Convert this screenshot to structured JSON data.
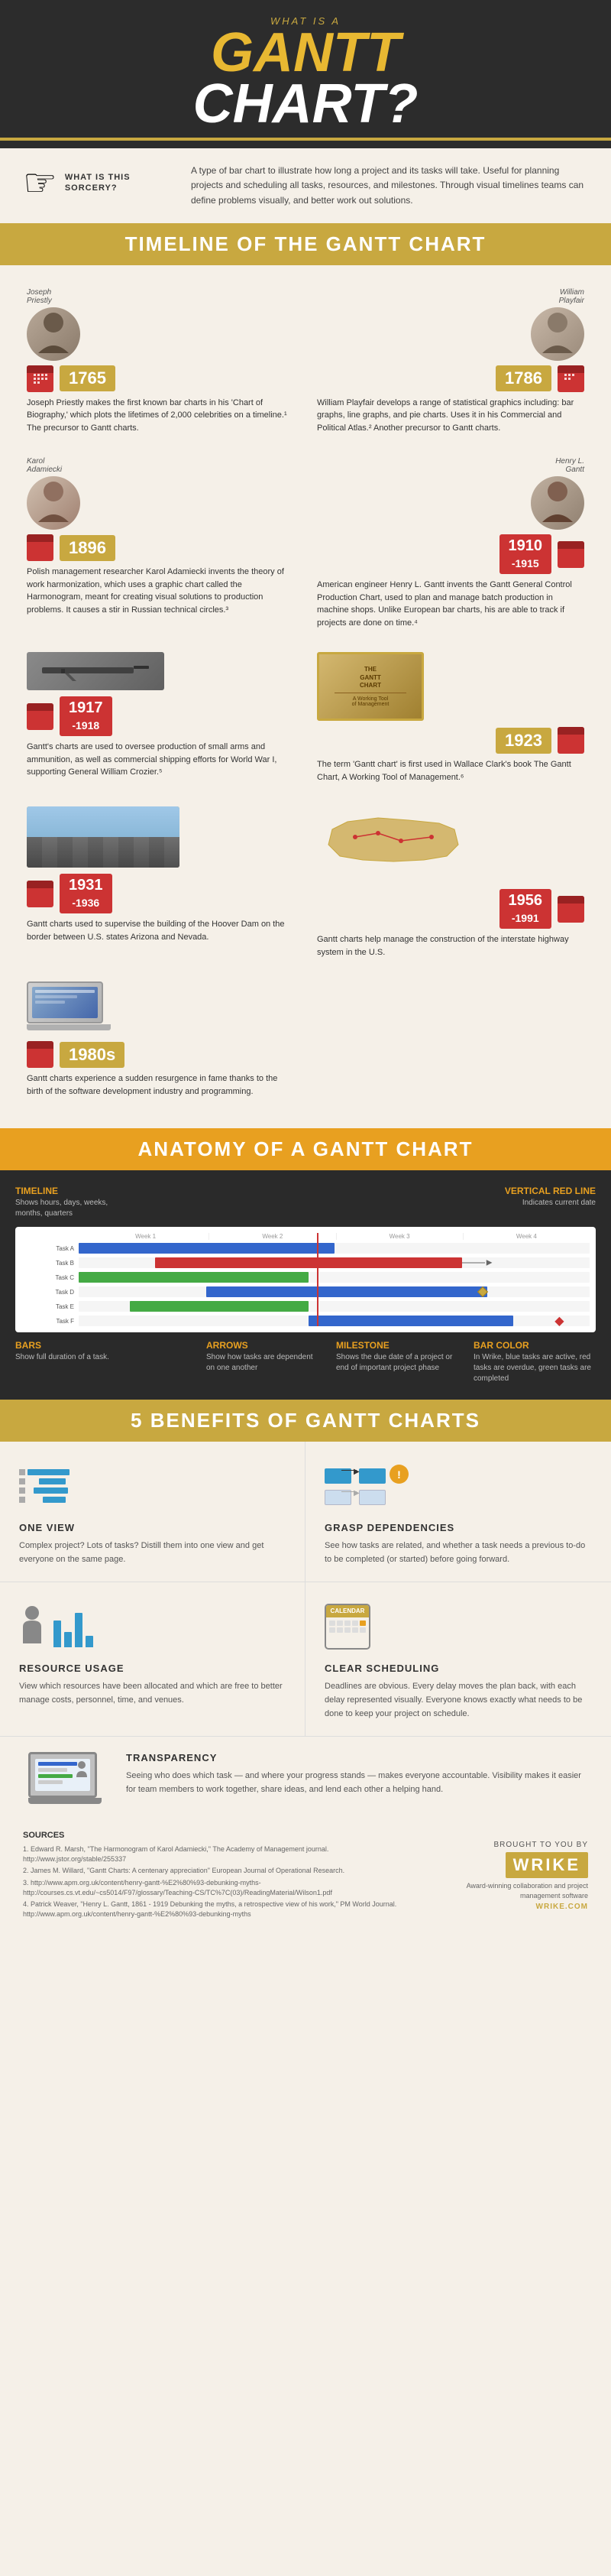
{
  "header": {
    "eyebrow": "What is a",
    "title_line1": "Gantt",
    "title_line2": "Chart?",
    "sorcery_label": "What is this\nSorcery?",
    "sorcery_text": "A type of bar chart to illustrate how long a project and its tasks will take. Useful for planning projects and scheduling all tasks, resources, and milestones. Through visual timelines teams can define problems visually, and better work out solutions."
  },
  "timeline": {
    "section_title": "Timeline of the Gantt Chart",
    "events": [
      {
        "year": "1765",
        "side": "left",
        "person": "Joseph Priestley",
        "text": "Joseph Priestly makes the first known bar charts in his 'Chart of Biography,' which plots the lifetimes of 2,000 celebrities on a timeline.¹ The precursor to Gantt charts."
      },
      {
        "year": "1786",
        "side": "right",
        "person": "William Playfair",
        "text": "William Playfair develops a range of statistical graphics including: bar graphs, line graphs, and pie charts. Uses it in his Commercial and Political Atlas.² Another precursor to Gantt charts."
      },
      {
        "year": "1896",
        "side": "left",
        "person": "Karol Adamiecki",
        "text": "Polish management researcher Karol Adamiecki invents the theory of work harmonization, which uses a graphic chart called the Harmonogram, meant for creating visual solutions to production problems. It causes a stir in Russian technical circles.³"
      },
      {
        "year": "1910\n-1915",
        "side": "right",
        "person": "Henry L. Gantt",
        "text": "American engineer Henry L. Gantt invents the Gantt General Control Production Chart, used to plan and manage batch production in machine shops. Unlike European bar charts, his are able to track if projects are done on time.⁴"
      },
      {
        "year": "1917\n-1918",
        "side": "left",
        "text": "Gantt's charts are used to oversee production of small arms and ammunition, as well as commercial shipping efforts for World War I, supporting General William Crozier.⁵"
      },
      {
        "year": "1923",
        "side": "right",
        "text": "The term 'Gantt chart' is first used in Wallace Clark's book The Gantt Chart, A Working Tool of Management.⁶"
      },
      {
        "year": "1931\n-1936",
        "side": "left",
        "text": "Gantt charts used to supervise the building of the Hoover Dam on the border between U.S. states Arizona and Nevada."
      },
      {
        "year": "1956\n-1991",
        "side": "right",
        "text": "Gantt charts help manage the construction of the interstate highway system in the U.S."
      },
      {
        "year": "1980s",
        "side": "left",
        "text": "Gantt charts experience a sudden resurgence in fame thanks to the birth of the software development industry and programming."
      }
    ]
  },
  "anatomy": {
    "section_title": "Anatomy of a Gantt Chart",
    "labels": {
      "timeline": {
        "title": "Timeline",
        "desc": "Shows hours, days, weeks, months, quarters"
      },
      "vertical_red_line": {
        "title": "Vertical Red Line",
        "desc": "Indicates current date"
      },
      "arrows": {
        "title": "Arrows",
        "desc": "Show how tasks are dependent on one another"
      },
      "milestone": {
        "title": "Milestone",
        "desc": "Shows the due date of a project or end of important project phase"
      },
      "bars": {
        "title": "Bars",
        "desc": "Show full duration of a task."
      },
      "bar_color": {
        "title": "Bar Color",
        "desc": "In Wrike, blue tasks are active, red tasks are overdue, green tasks are completed"
      }
    }
  },
  "benefits": {
    "section_title": "5 Benefits of Gantt Charts",
    "items": [
      {
        "id": "one-view",
        "title": "One View",
        "desc": "Complex project? Lots of tasks? Distill them into one view and get everyone on the same page."
      },
      {
        "id": "grasp-dependencies",
        "title": "Grasp Dependencies",
        "desc": "See how tasks are related, and whether a task needs a previous to-do to be completed (or started) before going forward."
      },
      {
        "id": "resource-usage",
        "title": "Resource Usage",
        "desc": "View which resources have been allocated and which are free to better manage costs, personnel, time, and venues."
      },
      {
        "id": "clear-scheduling",
        "title": "Clear Scheduling",
        "desc": "Deadlines are obvious. Every delay moves the plan back, with each delay represented visually. Everyone knows exactly what needs to be done to keep your project on schedule."
      },
      {
        "id": "transparency",
        "title": "Transparency",
        "desc": "Seeing who does which task — and where your progress stands — makes everyone accountable. Visibility makes it easier for team members to work together, share ideas, and lend each other a helping hand."
      }
    ]
  },
  "sources": {
    "title": "Sources",
    "items": [
      "1. Edward R. Marsh, \"The Harmonogram of Karol Adamiecki,\" The Academy of Management journal. http://www.jstor.org/stable/255337",
      "2. James M. Willard, \"Gantt Charts: A centenary appreciation\" European Journal of Operational Research.",
      "3. http://www.apm.org.uk/content/henry-gantt-%E2%80%93-debunking-myths-http://courses.cs.vt.edu/~cs5014/F97/glossary/Teaching-CS/TC%7C(03)/ReadingMaterial/Wilson1.pdf",
      "4. Patrick Weaver, \"Henry L. Gantt, 1861 - 1919 Debunking the myths, a retrospective view of his work,\" PM World Journal. http://www.apm.org.uk/content/henry-gantt-%E2%80%93-debunking-myths"
    ]
  },
  "wrike": {
    "brought_by": "Brought to you by",
    "logo": "Wrike",
    "tagline": "Award-winning collaboration and\nproject management software",
    "url": "WRIKE.COM"
  },
  "colors": {
    "gold": "#c8a840",
    "orange": "#e8a020",
    "red": "#cc3333",
    "dark": "#2c2c2c",
    "blue": "#3366cc",
    "green": "#44aa44"
  }
}
